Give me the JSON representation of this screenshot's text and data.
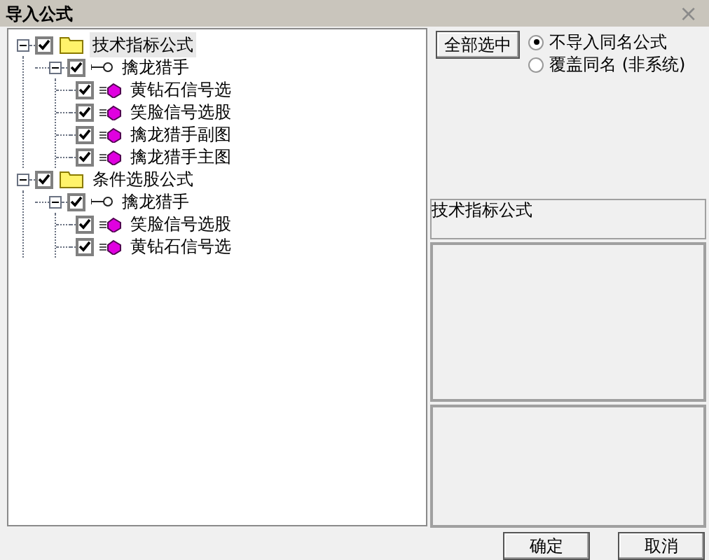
{
  "window": {
    "title": "导入公式",
    "close": "×"
  },
  "tree": [
    {
      "kind": "folder",
      "label": "技术指标公式",
      "checked": true,
      "expanded": true,
      "selected": true,
      "children": [
        {
          "kind": "group",
          "label": "擒龙猎手",
          "checked": true,
          "expanded": true,
          "selected": false,
          "children": [
            {
              "kind": "formula",
              "label": "黄钻石信号选",
              "checked": true,
              "selected": false
            },
            {
              "kind": "formula",
              "label": "笑脸信号选股",
              "checked": true,
              "selected": false
            },
            {
              "kind": "formula",
              "label": "擒龙猎手副图",
              "checked": true,
              "selected": false
            },
            {
              "kind": "formula",
              "label": "擒龙猎手主图",
              "checked": true,
              "selected": false
            }
          ]
        }
      ]
    },
    {
      "kind": "folder",
      "label": "条件选股公式",
      "checked": true,
      "expanded": true,
      "selected": false,
      "children": [
        {
          "kind": "group",
          "label": "擒龙猎手",
          "checked": true,
          "expanded": true,
          "selected": false,
          "children": [
            {
              "kind": "formula",
              "label": "笑脸信号选股",
              "checked": true,
              "selected": false
            },
            {
              "kind": "formula",
              "label": "黄钻石信号选",
              "checked": true,
              "selected": false
            }
          ]
        }
      ]
    }
  ],
  "select_all_button": "全部选中",
  "options": [
    {
      "label": "不导入同名公式",
      "selected": true
    },
    {
      "label": "覆盖同名 (非系统)",
      "selected": false
    }
  ],
  "description": "技术指标公式",
  "buttons": [
    "确定",
    "取消"
  ]
}
